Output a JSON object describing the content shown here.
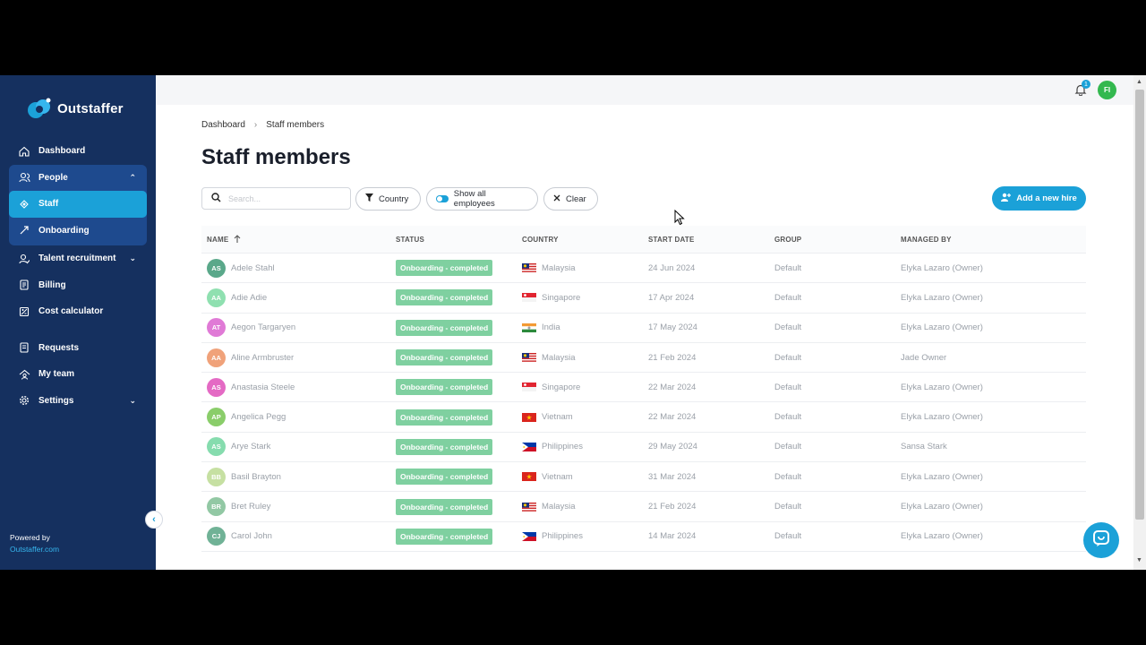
{
  "app": {
    "logo_text": "Outstaffer"
  },
  "sidebar": {
    "items": [
      {
        "label": "Dashboard",
        "icon": "home-icon"
      },
      {
        "label": "People",
        "icon": "people-icon"
      },
      {
        "label": "Staff",
        "icon": "staff-icon"
      },
      {
        "label": "Onboarding",
        "icon": "onboarding-icon"
      },
      {
        "label": "Talent recruitment",
        "icon": "recruitment-icon"
      },
      {
        "label": "Billing",
        "icon": "billing-icon"
      },
      {
        "label": "Cost calculator",
        "icon": "calculator-icon"
      },
      {
        "label": "Requests",
        "icon": "requests-icon"
      },
      {
        "label": "My team",
        "icon": "team-icon"
      },
      {
        "label": "Settings",
        "icon": "gear-icon"
      }
    ],
    "powered_by": "Powered by",
    "powered_link": "Outstaffer.com"
  },
  "topbar": {
    "notification_count": "1",
    "user_initials": "FI"
  },
  "breadcrumb": {
    "home": "Dashboard",
    "current": "Staff members"
  },
  "page": {
    "title": "Staff members"
  },
  "toolbar": {
    "search_placeholder": "Search...",
    "country_label": "Country",
    "show_all_label": "Show all employees",
    "clear_label": "Clear",
    "add_hire_label": "Add a new hire"
  },
  "table": {
    "headers": {
      "name": "NAME",
      "status": "STATUS",
      "country": "COUNTRY",
      "start_date": "START DATE",
      "group": "GROUP",
      "managed_by": "MANAGED BY"
    },
    "rows": [
      {
        "initials": "AS",
        "name": "Adele Stahl",
        "status": "Onboarding - completed",
        "country": "Malaysia",
        "start_date": "24 Jun 2024",
        "group": "Default",
        "managed_by": "Elyka Lazaro (Owner)",
        "color": "#5aa88a"
      },
      {
        "initials": "AA",
        "name": "Adie Adie",
        "status": "Onboarding - completed",
        "country": "Singapore",
        "start_date": "17 Apr 2024",
        "group": "Default",
        "managed_by": "Elyka Lazaro (Owner)",
        "color": "#8fe0b0"
      },
      {
        "initials": "AT",
        "name": "Aegon Targaryen",
        "status": "Onboarding - completed",
        "country": "India",
        "start_date": "17 May 2024",
        "group": "Default",
        "managed_by": "Elyka Lazaro (Owner)",
        "color": "#e07ad6"
      },
      {
        "initials": "AA",
        "name": "Aline Armbruster",
        "status": "Onboarding - completed",
        "country": "Malaysia",
        "start_date": "21 Feb 2024",
        "group": "Default",
        "managed_by": "Jade Owner",
        "color": "#f0a27a"
      },
      {
        "initials": "AS",
        "name": "Anastasia Steele",
        "status": "Onboarding - completed",
        "country": "Singapore",
        "start_date": "22 Mar 2024",
        "group": "Default",
        "managed_by": "Elyka Lazaro (Owner)",
        "color": "#e46ac4"
      },
      {
        "initials": "AP",
        "name": "Angelica Pegg",
        "status": "Onboarding - completed",
        "country": "Vietnam",
        "start_date": "22 Mar 2024",
        "group": "Default",
        "managed_by": "Elyka Lazaro (Owner)",
        "color": "#8acd6a"
      },
      {
        "initials": "AS",
        "name": "Arye Stark",
        "status": "Onboarding - completed",
        "country": "Philippines",
        "start_date": "29 May 2024",
        "group": "Default",
        "managed_by": "Sansa Stark",
        "color": "#86dcae"
      },
      {
        "initials": "BB",
        "name": "Basil Brayton",
        "status": "Onboarding - completed",
        "country": "Vietnam",
        "start_date": "31 Mar 2024",
        "group": "Default",
        "managed_by": "Elyka Lazaro (Owner)",
        "color": "#c6e0a2"
      },
      {
        "initials": "BR",
        "name": "Bret Ruley",
        "status": "Onboarding - completed",
        "country": "Malaysia",
        "start_date": "21 Feb 2024",
        "group": "Default",
        "managed_by": "Elyka Lazaro (Owner)",
        "color": "#92c8a4"
      },
      {
        "initials": "CJ",
        "name": "Carol John",
        "status": "Onboarding - completed",
        "country": "Philippines",
        "start_date": "14 Mar 2024",
        "group": "Default",
        "managed_by": "Elyka Lazaro (Owner)",
        "color": "#70b296"
      }
    ]
  },
  "colors": {
    "sidebar": "#15305f",
    "accent": "#1ba1d8",
    "status_badge": "#7fd0a0"
  }
}
